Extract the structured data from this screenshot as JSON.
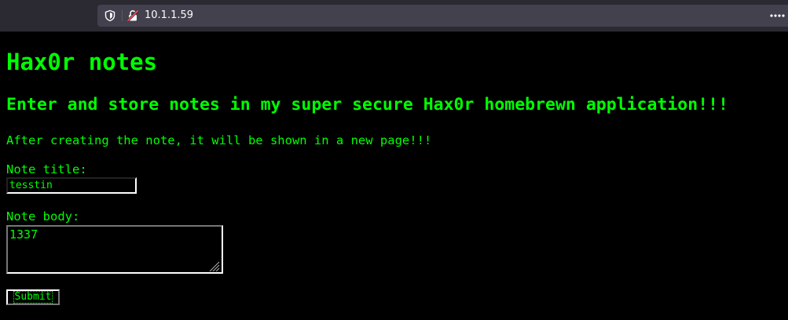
{
  "browser": {
    "url": "10.1.1.59",
    "icons": {
      "tracking_protection": "shield-icon",
      "connection": "insecure-lock-icon",
      "page_actions": "more-icon"
    }
  },
  "page": {
    "title": "Hax0r notes",
    "subtitle": "Enter and store notes in my super secure Hax0r homebrewn application!!!",
    "info": "After creating the note, it will be shown in a new page!!!",
    "form": {
      "title_label": "Note title:",
      "title_value": "tesstin",
      "body_label": "Note body:",
      "body_value": "1337",
      "submit_label": "Submit"
    }
  },
  "colors": {
    "page_background": "#000000",
    "text": "#00ff00",
    "chrome_background": "#2b2a33",
    "urlbar_background": "#42414d"
  }
}
